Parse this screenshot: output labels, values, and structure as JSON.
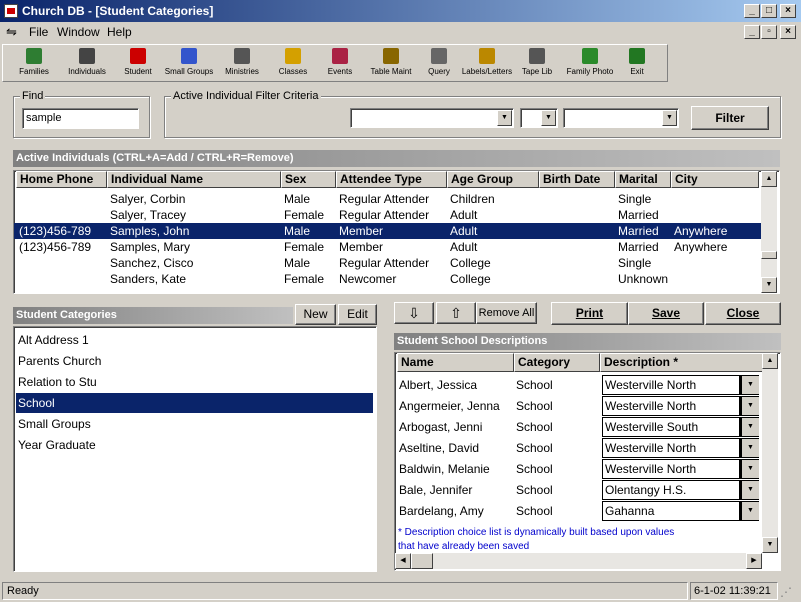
{
  "window": {
    "title": "Church DB - [Student Categories]"
  },
  "menu": [
    {
      "label": "File"
    },
    {
      "label": "Window"
    },
    {
      "label": "Help"
    }
  ],
  "toolbar": [
    {
      "label": "Families",
      "icon": "families-icon",
      "color": "#2e7d32"
    },
    {
      "label": "Individuals",
      "icon": "individuals-icon",
      "color": "#444444"
    },
    {
      "label": "Student",
      "icon": "student-icon",
      "color": "#cc0000"
    },
    {
      "label": "Small Groups",
      "icon": "small-groups-icon",
      "color": "#3355cc"
    },
    {
      "label": "Ministries",
      "icon": "ministries-icon",
      "color": "#555555"
    },
    {
      "label": "Classes",
      "icon": "classes-icon",
      "color": "#d4a000"
    },
    {
      "label": "Events",
      "icon": "events-icon",
      "color": "#aa2244"
    },
    {
      "label": "Table Maint",
      "icon": "table-maint-icon",
      "color": "#886600"
    },
    {
      "label": "Query",
      "icon": "query-icon",
      "color": "#666666"
    },
    {
      "label": "Labels/Letters",
      "icon": "labels-letters-icon",
      "color": "#bb8800"
    },
    {
      "label": "Tape Lib",
      "icon": "tape-lib-icon",
      "color": "#555555"
    },
    {
      "label": "Family Photo",
      "icon": "family-photo-icon",
      "color": "#2a8a2a"
    },
    {
      "label": "Exit",
      "icon": "exit-icon",
      "color": "#227722"
    }
  ],
  "find": {
    "label": "Find",
    "value": "sample"
  },
  "filter": {
    "label": "Active Individual Filter Criteria",
    "button": "Filter"
  },
  "individuals": {
    "header": "Active Individuals   (CTRL+A=Add / CTRL+R=Remove)",
    "columns": [
      "Home Phone",
      "Individual Name",
      "Sex",
      "Attendee Type",
      "Age Group",
      "Birth Date",
      "Marital",
      "City"
    ],
    "rows": [
      [
        "",
        "Salyer, Corbin",
        "Male",
        "Regular Attender",
        "Children",
        "",
        "Single",
        ""
      ],
      [
        "",
        "Salyer, Tracey",
        "Female",
        "Regular Attender",
        "Adult",
        "",
        "Married",
        ""
      ],
      [
        "(123)456-789",
        "Samples, John",
        "Male",
        "Member",
        "Adult",
        "",
        "Married",
        "Anywhere"
      ],
      [
        "(123)456-789",
        "Samples, Mary",
        "Female",
        "Member",
        "Adult",
        "",
        "Married",
        "Anywhere"
      ],
      [
        "",
        "Sanchez, Cisco",
        "Male",
        "Regular Attender",
        "College",
        "",
        "Single",
        ""
      ],
      [
        "",
        "Sanders, Kate",
        "Female",
        "Newcomer",
        "College",
        "",
        "Unknown",
        ""
      ]
    ],
    "selected": 2
  },
  "categories": {
    "header": "Student Categories",
    "new": "New",
    "edit": "Edit",
    "items": [
      "Alt Address 1",
      "Parents Church",
      "Relation to Stu",
      "School",
      "Small Groups",
      "Year Graduate"
    ],
    "selected": 3
  },
  "actions": {
    "down": "⇩",
    "up": "⇧",
    "remove_all": "Remove All",
    "print": "Print",
    "save": "Save",
    "close": "Close"
  },
  "descriptions": {
    "header": "Student School Descriptions",
    "columns": [
      "Name",
      "Category",
      "Description *"
    ],
    "rows": [
      [
        "Albert, Jessica",
        "School",
        "Westerville North"
      ],
      [
        "Angermeier, Jenna",
        "School",
        "Westerville North"
      ],
      [
        "Arbogast, Jenni",
        "School",
        "Westerville South"
      ],
      [
        "Aseltine, David",
        "School",
        "Westerville North"
      ],
      [
        "Baldwin, Melanie",
        "School",
        "Westerville North"
      ],
      [
        "Bale, Jennifer",
        "School",
        "Olentangy H.S."
      ],
      [
        "Bardelang, Amy",
        "School",
        "Gahanna"
      ]
    ],
    "note": "* Description choice list is dynamically built based upon values that have already been saved"
  },
  "status": {
    "text": "Ready",
    "datetime": "6-1-02 11:39:21"
  }
}
